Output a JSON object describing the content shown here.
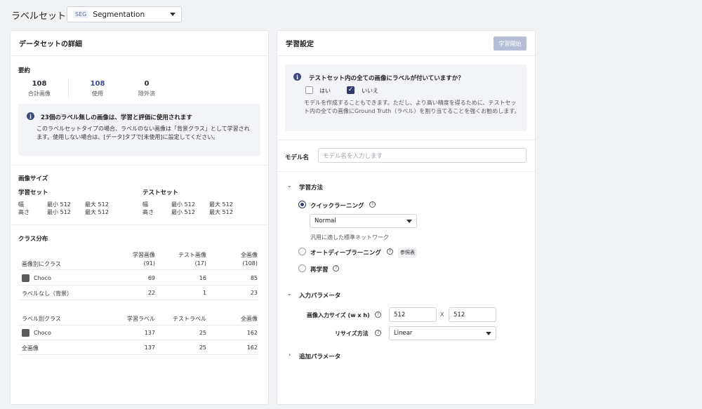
{
  "header": {
    "title": "ラベルセット",
    "select_tag": "SEG",
    "select_value": "Segmentation"
  },
  "left": {
    "title": "データセットの詳細",
    "summary": {
      "label": "要約",
      "stats": [
        {
          "value": "108",
          "label": "合計画像"
        },
        {
          "value": "108",
          "label": "使用"
        },
        {
          "value": "0",
          "label": "除外済"
        }
      ]
    },
    "info": {
      "title": "23個のラベル無しの画像は、学習と評価に使用されます",
      "body": "このラベルセットタイプの場合、ラベルのない画像は「背景クラス」として学習されます。使用しない場合は、[データ]タブで[未使用]に設定してください。"
    },
    "image_size": {
      "label": "画像サイズ",
      "train": {
        "title": "学習セット",
        "width_label": "幅",
        "height_label": "高さ",
        "width_min": "最小 512",
        "width_max": "最大 512",
        "height_min": "最小 512",
        "height_max": "最大 512"
      },
      "test": {
        "title": "テストセット",
        "width_label": "幅",
        "height_label": "高さ",
        "width_min": "最小 512",
        "width_max": "最大 512",
        "height_min": "最小 512",
        "height_max": "最大 512"
      }
    },
    "class_dist": {
      "label": "クラス分布",
      "table1": {
        "headers": [
          "画像別にクラス",
          "学習画像\n(91)",
          "テスト画像\n(17)",
          "全画像\n(108)"
        ],
        "rows": [
          {
            "name": "Choco",
            "v1": "69",
            "v2": "16",
            "v3": "85"
          },
          {
            "name": "ラベルなし（背景）",
            "v1": "22",
            "v2": "1",
            "v3": "23"
          }
        ]
      },
      "table2": {
        "headers": [
          "ラベル別クラス",
          "学習ラベル",
          "テストラベル",
          "全画像"
        ],
        "rows": [
          {
            "name": "Choco",
            "v1": "137",
            "v2": "25",
            "v3": "162"
          },
          {
            "name": "全画像",
            "v1": "137",
            "v2": "25",
            "v3": "162"
          }
        ]
      }
    }
  },
  "right": {
    "title": "学習設定",
    "train_button": "学習開始",
    "question": {
      "title": "テストセット内の全ての画像にラベルが付いていますか？",
      "yes": "はい",
      "no": "いいえ",
      "body": "モデルを作成することもできます。ただし、より高い精度を得るために、テストセット内の全ての画像にGround Truth（ラベル）を割り当てることを強くお勧めします。"
    },
    "model_name": {
      "label": "モデル名",
      "placeholder": "モデル名を入力します"
    },
    "method": {
      "label": "学習方法",
      "options": [
        {
          "label": "クイックラーニング",
          "selected": true
        },
        {
          "label": "オートディープラーニング",
          "selected": false,
          "badge": "参照表"
        },
        {
          "label": "再学習",
          "selected": false
        }
      ],
      "quick_select": "Normal",
      "quick_desc": "汎用に適した標準ネットワーク"
    },
    "input_params": {
      "label": "入力パラメータ",
      "size_label": "画像入力サイズ (w x h)",
      "width": "512",
      "x": "X",
      "height": "512",
      "resize_label": "リサイズ方法",
      "resize_value": "Linear"
    },
    "additional": {
      "label": "追加パラメータ"
    }
  }
}
